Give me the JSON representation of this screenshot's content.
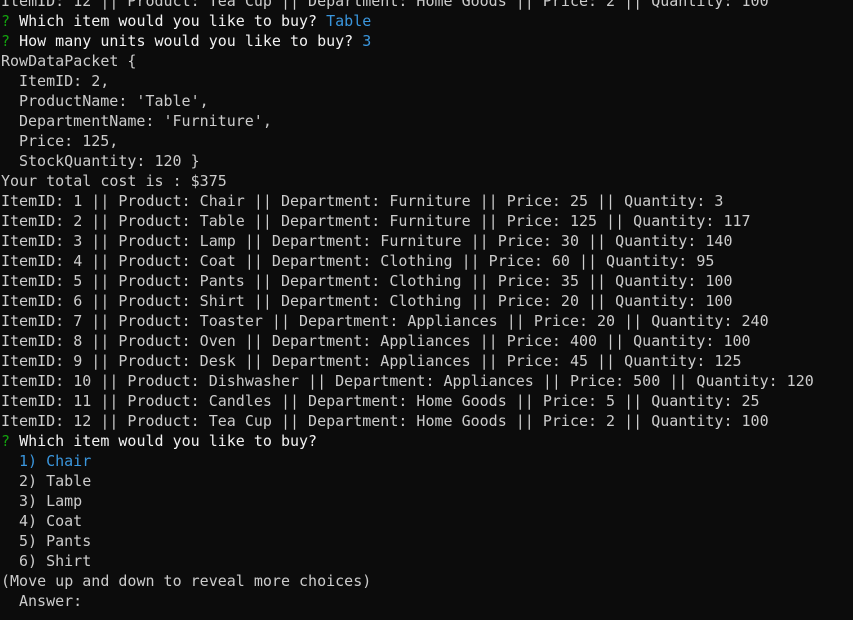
{
  "colors": {
    "background": "#0c0c0c",
    "text": "#cccccc",
    "bright_text": "#f2f2f2",
    "prompt_mark": "#13a10e",
    "answer": "#3a96dd"
  },
  "prompt_mark": "?",
  "top_partial_line": "ItemID: 12 || Product: Tea Cup || Department: Home Goods || Price: 2 || Quantity: 100",
  "prompt_item": {
    "question": "Which item would you like to buy?",
    "answer": "Table"
  },
  "prompt_units": {
    "question": "How many units would you like to buy?",
    "answer": "3"
  },
  "row_data_packet": [
    "RowDataPacket {",
    "ItemID: 2,",
    "ProductName: 'Table',",
    "DepartmentName: 'Furniture',",
    "Price: 125,",
    "StockQuantity: 120 }"
  ],
  "total_cost": "Your total cost is : $375",
  "inventory": [
    "ItemID: 1 || Product: Chair || Department: Furniture || Price: 25 || Quantity: 3",
    "ItemID: 2 || Product: Table || Department: Furniture || Price: 125 || Quantity: 117",
    "ItemID: 3 || Product: Lamp || Department: Furniture || Price: 30 || Quantity: 140",
    "ItemID: 4 || Product: Coat || Department: Clothing || Price: 60 || Quantity: 95",
    "ItemID: 5 || Product: Pants || Department: Clothing || Price: 35 || Quantity: 100",
    "ItemID: 6 || Product: Shirt || Department: Clothing || Price: 20 || Quantity: 100",
    "ItemID: 7 || Product: Toaster || Department: Appliances || Price: 20 || Quantity: 240",
    "ItemID: 8 || Product: Oven || Department: Appliances || Price: 400 || Quantity: 100",
    "ItemID: 9 || Product: Desk || Department: Appliances || Price: 45 || Quantity: 125",
    "ItemID: 10 || Product: Dishwasher || Department: Appliances || Price: 500 || Quantity: 120",
    "ItemID: 11 || Product: Candles || Department: Home Goods || Price: 5 || Quantity: 25",
    "ItemID: 12 || Product: Tea Cup || Department: Home Goods || Price: 2 || Quantity: 100"
  ],
  "prompt_current": {
    "question": "Which item would you like to buy?"
  },
  "choices": [
    "1) Chair",
    "2) Table",
    "3) Lamp",
    "4) Coat",
    "5) Pants",
    "6) Shirt"
  ],
  "selected_choice_index": 0,
  "hint": "(Move up and down to reveal more choices)",
  "answer_label": "Answer:"
}
